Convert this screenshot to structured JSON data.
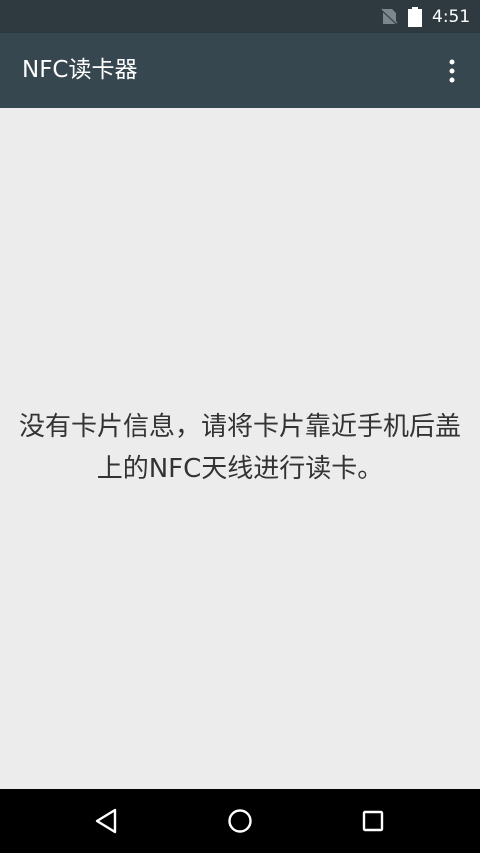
{
  "status_bar": {
    "time": "4:51",
    "icons": [
      "no-sim-icon",
      "battery-icon"
    ]
  },
  "app_bar": {
    "title": "NFC读卡器",
    "menu_icon": "more-vert-icon"
  },
  "main": {
    "message": "没有卡片信息，请将卡片靠近手机后盖上的NFC天线进行读卡。"
  },
  "nav_bar": {
    "buttons": [
      "back-icon",
      "home-icon",
      "recents-icon"
    ]
  },
  "colors": {
    "status_bar_bg": "#2e3a40",
    "app_bar_bg": "#37474f",
    "content_bg": "#ececec",
    "nav_bar_bg": "#000000"
  }
}
